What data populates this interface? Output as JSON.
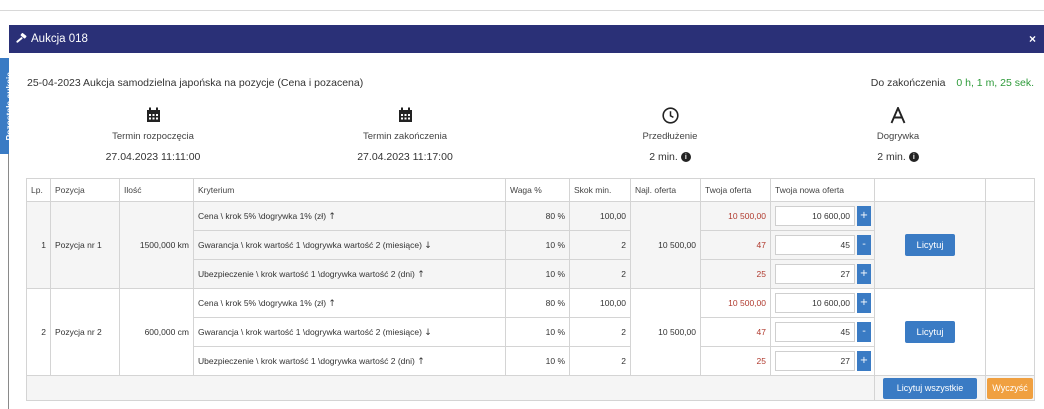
{
  "side_tab": {
    "label": "Pozostałe aukcje"
  },
  "modal": {
    "title": "Aukcja 018",
    "close": "×",
    "description": "25-04-2023 Aukcja samodzielna japońska na pozycje (Cena i pozacena)",
    "countdown_label": "Do zakończenia",
    "countdown_value": "0 h, 1 m, 25 sek.",
    "accent_color": "#2a3077"
  },
  "stats": [
    {
      "icon": "calendar-icon",
      "label": "Termin rozpoczęcia",
      "value": "27.04.2023 11:11:00",
      "info": false
    },
    {
      "icon": "calendar-icon",
      "label": "Termin zakończenia",
      "value": "27.04.2023 11:17:00",
      "info": false
    },
    {
      "icon": "clock-icon",
      "label": "Przedłużenie",
      "value": "2 min.",
      "info": true
    },
    {
      "icon": "letter-a-icon",
      "label": "Dogrywka",
      "value": "2 min.",
      "info": true
    }
  ],
  "table": {
    "headers": [
      "Lp.",
      "Pozycja",
      "Ilość",
      "Kryterium",
      "Waga %",
      "Skok min.",
      "Najl. oferta",
      "Twoja oferta",
      "Twoja nowa oferta"
    ],
    "positions": [
      {
        "lp": "1",
        "name": "Pozycja nr 1",
        "qty": "1500,000 km",
        "best": "10 500,00",
        "bid_label": "Licytuj",
        "criteria": [
          {
            "text": "Cena \\ krok 5% \\dogrywka 1% (zł)",
            "arrow": "↑",
            "weight": "80 %",
            "step": "100,00",
            "your": "10 500,00",
            "new": "10 600,00",
            "btn": "+"
          },
          {
            "text": "Gwarancja \\ krok wartość 1 \\dogrywka wartość 2 (miesiące)",
            "arrow": "↓",
            "weight": "10 %",
            "step": "2",
            "your": "47",
            "new": "45",
            "btn": "-"
          },
          {
            "text": "Ubezpieczenie \\ krok wartość 1 \\dogrywka wartość 2 (dni)",
            "arrow": "↑",
            "weight": "10 %",
            "step": "2",
            "your": "25",
            "new": "27",
            "btn": "+"
          }
        ]
      },
      {
        "lp": "2",
        "name": "Pozycja nr 2",
        "qty": "600,000 cm",
        "best": "10 500,00",
        "bid_label": "Licytuj",
        "criteria": [
          {
            "text": "Cena \\ krok 5% \\dogrywka 1% (zł)",
            "arrow": "↑",
            "weight": "80 %",
            "step": "100,00",
            "your": "10 500,00",
            "new": "10 600,00",
            "btn": "+"
          },
          {
            "text": "Gwarancja \\ krok wartość 1 \\dogrywka wartość 2 (miesiące)",
            "arrow": "↓",
            "weight": "10 %",
            "step": "2",
            "your": "47",
            "new": "45",
            "btn": "-"
          },
          {
            "text": "Ubezpieczenie \\ krok wartość 1 \\dogrywka wartość 2 (dni)",
            "arrow": "↑",
            "weight": "10 %",
            "step": "2",
            "your": "25",
            "new": "27",
            "btn": "+"
          }
        ]
      }
    ],
    "footer": {
      "bid_all": "Licytuj wszystkie",
      "clear": "Wyczyść"
    },
    "colors": {
      "primary_button": "#3a7bc4",
      "clear_button": "#f0a040",
      "your_offer": "#b03a2e",
      "countdown": "#2e9b3a"
    }
  }
}
